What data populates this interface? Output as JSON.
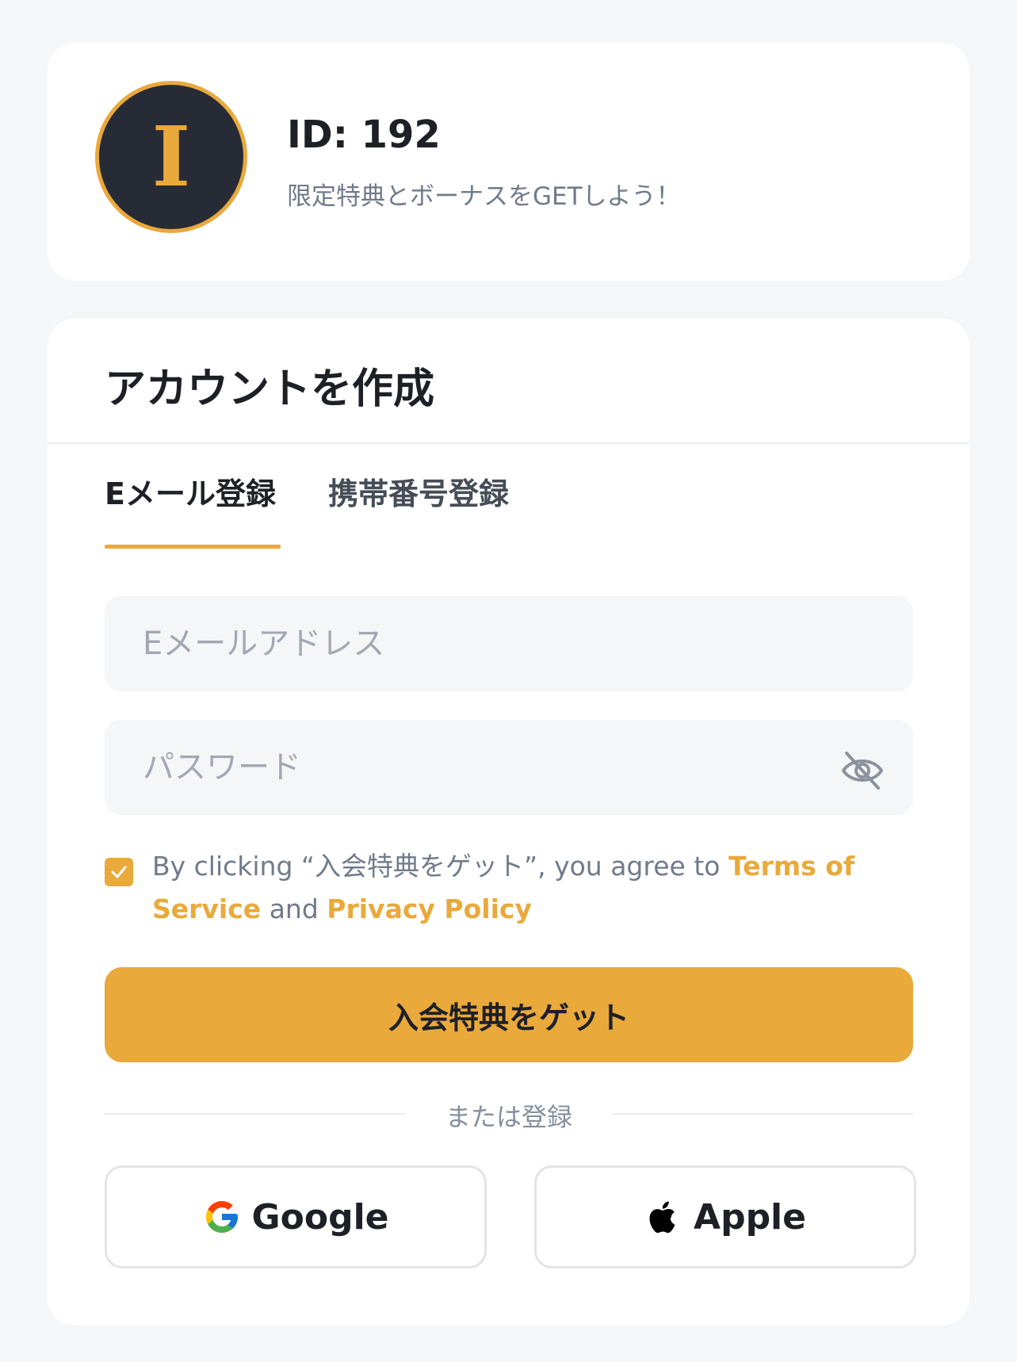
{
  "profile": {
    "avatar_letter": "I",
    "user_id": "ID: 192",
    "promo": "限定特典とボーナスをGETしよう！"
  },
  "signup": {
    "title": "アカウントを作成",
    "tabs": [
      {
        "label": "Eメール登録",
        "active": true
      },
      {
        "label": "携帯番号登録",
        "active": false
      }
    ],
    "email": {
      "placeholder": "Eメールアドレス",
      "value": ""
    },
    "password": {
      "placeholder": "パスワード",
      "value": ""
    },
    "agreement": {
      "checked": true,
      "prefix": "By clicking “入会特典をゲット”, you agree to ",
      "terms_link": "Terms of Service",
      "and": " and ",
      "privacy_link": "Privacy Policy"
    },
    "submit_label": "入会特典をゲット",
    "or_label": "または登録",
    "social": [
      {
        "label": "Google",
        "icon": "google-icon"
      },
      {
        "label": "Apple",
        "icon": "apple-icon"
      }
    ]
  },
  "colors": {
    "accent": "#e9a93b",
    "avatar_bg": "#272b35",
    "page_bg": "#f5f6f8",
    "text_primary": "#1e2026",
    "text_secondary": "#707a8a"
  }
}
